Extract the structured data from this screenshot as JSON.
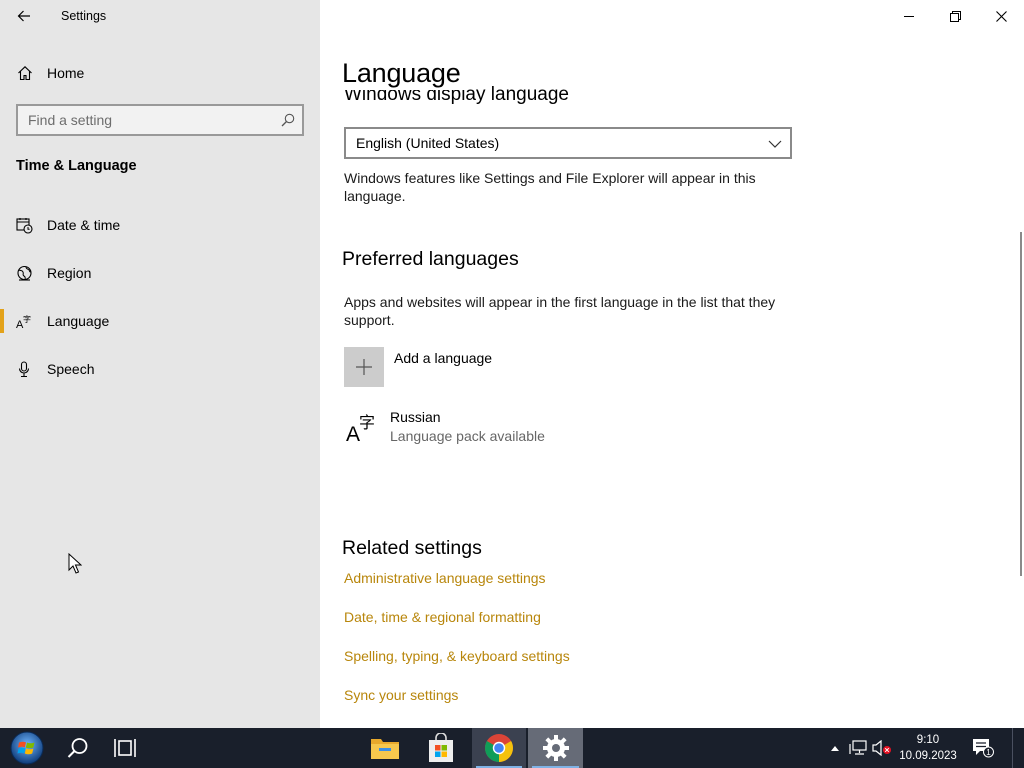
{
  "window": {
    "app_title": "Settings"
  },
  "sidebar": {
    "home_label": "Home",
    "search_placeholder": "Find a setting",
    "section_title": "Time & Language",
    "items": [
      {
        "label": "Date & time",
        "icon": "calendar-clock-icon",
        "selected": false
      },
      {
        "label": "Region",
        "icon": "globe-icon",
        "selected": false
      },
      {
        "label": "Language",
        "icon": "language-icon",
        "selected": true
      },
      {
        "label": "Speech",
        "icon": "microphone-icon",
        "selected": false
      }
    ],
    "accent_color": "#e3a21a"
  },
  "main": {
    "page_title": "Language",
    "display_language": {
      "heading": "Windows display language",
      "selected_value": "English (United States)",
      "description": "Windows features like Settings and File Explorer will appear in this language."
    },
    "preferred_languages": {
      "heading": "Preferred languages",
      "description": "Apps and websites will appear in the first language in the list that they support.",
      "add_label": "Add a language",
      "languages": [
        {
          "name": "Russian",
          "status": "Language pack available"
        }
      ]
    },
    "related_settings": {
      "heading": "Related settings",
      "links": [
        "Administrative language settings",
        "Date, time & regional formatting",
        "Spelling, typing, & keyboard settings",
        "Sync your settings"
      ],
      "link_color": "#b8860b"
    }
  },
  "taskbar": {
    "time": "9:10",
    "date": "10.09.2023",
    "notification_count": "1",
    "pinned": [
      "start-icon",
      "search-icon",
      "task-view-icon",
      "file-explorer-icon",
      "store-icon",
      "chrome-icon",
      "settings-icon"
    ]
  }
}
